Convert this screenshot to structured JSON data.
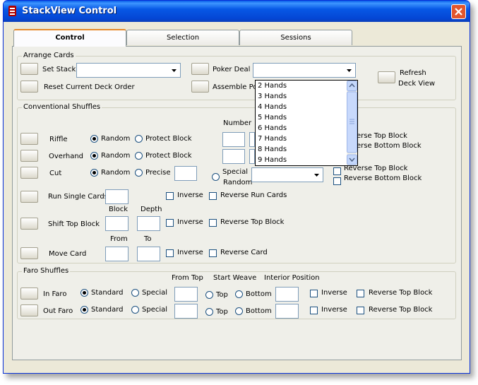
{
  "window": {
    "title": "StackView Control"
  },
  "tabs": [
    {
      "label": "Control",
      "active": true
    },
    {
      "label": "Selection",
      "active": false
    },
    {
      "label": "Sessions",
      "active": false
    }
  ],
  "arrange": {
    "title": "Arrange Cards",
    "set_stack": "Set Stack",
    "reset": "Reset Current Deck Order",
    "poker_deal": "Poker Deal",
    "assemble": "Assemble Po",
    "refresh_line1": "Refresh",
    "refresh_line2": "Deck View",
    "hands": [
      "2 Hands",
      "3 Hands",
      "4 Hands",
      "5 Hands",
      "6 Hands",
      "7 Hands",
      "8 Hands",
      "9 Hands"
    ]
  },
  "conventional": {
    "title": "Conventional Shuffles",
    "number": "Number",
    "riffle": "Riffle",
    "overhand": "Overhand",
    "cut": "Cut",
    "random": "Random",
    "protect_block": "Protect Block",
    "precise": "Precise",
    "special": "Special",
    "random2": "Random",
    "rev_top_block_1": "erse Top Block",
    "rev_bottom_block_1": "erse Bottom Block",
    "rev_top_block_2": "Reverse Top Block",
    "rev_bottom_block_2": "Reverse Bottom Block",
    "run_single": "Run Single Cards",
    "inverse": "Inverse",
    "rev_run_cards": "Reverse Run Cards",
    "block": "Block",
    "depth": "Depth",
    "shift_top": "Shift Top Block",
    "rev_top_block": "Reverse Top Block",
    "from": "From",
    "to": "To",
    "move_card": "Move Card",
    "rev_card": "Reverse Card"
  },
  "faro": {
    "title": "Faro Shuffles",
    "from_top": "From Top",
    "start_weave": "Start Weave",
    "interior": "Interior Position",
    "in_faro": "In Faro",
    "out_faro": "Out Faro",
    "standard": "Standard",
    "special": "Special",
    "top": "Top",
    "bottom": "Bottom",
    "inverse": "Inverse",
    "rev_top_block": "Reverse Top Block"
  }
}
